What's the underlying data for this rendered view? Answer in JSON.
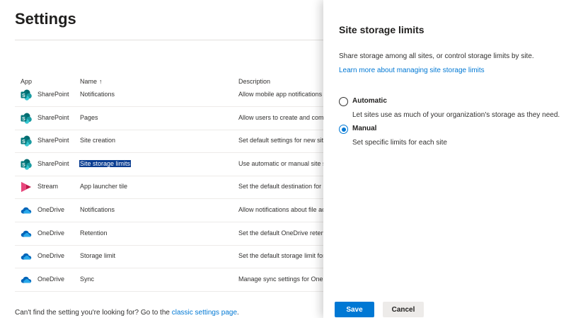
{
  "page": {
    "title": "Settings",
    "columns": {
      "app": "App",
      "name": "Name",
      "name_sort_icon": "sort-ascending-icon",
      "description": "Description"
    },
    "rows": [
      {
        "app": "SharePoint",
        "icon": "sharepoint-icon",
        "name": "Notifications",
        "description": "Allow mobile app notifications al"
      },
      {
        "app": "SharePoint",
        "icon": "sharepoint-icon",
        "name": "Pages",
        "description": "Allow users to create and comm"
      },
      {
        "app": "SharePoint",
        "icon": "sharepoint-icon",
        "name": "Site creation",
        "description": "Set default settings for new sites"
      },
      {
        "app": "SharePoint",
        "icon": "sharepoint-icon",
        "name": "Site storage limits",
        "description": "Use automatic or manual site sto",
        "selected": true
      },
      {
        "app": "Stream",
        "icon": "stream-icon",
        "name": "App launcher tile",
        "description": "Set the default destination for St"
      },
      {
        "app": "OneDrive",
        "icon": "onedrive-icon",
        "name": "Notifications",
        "description": "Allow notifications about file acti"
      },
      {
        "app": "OneDrive",
        "icon": "onedrive-icon",
        "name": "Retention",
        "description": "Set the default OneDrive retentic"
      },
      {
        "app": "OneDrive",
        "icon": "onedrive-icon",
        "name": "Storage limit",
        "description": "Set the default storage limit for u"
      },
      {
        "app": "OneDrive",
        "icon": "onedrive-icon",
        "name": "Sync",
        "description": "Manage sync settings for OneDri"
      }
    ],
    "footer_text": "Can't find the setting you're looking for? Go to the ",
    "footer_link": "classic settings page",
    "footer_end": "."
  },
  "panel": {
    "title": "Site storage limits",
    "description": "Share storage among all sites, or control storage limits by site.",
    "learn_more": "Learn more about managing site storage limits",
    "options": [
      {
        "label": "Automatic",
        "description": "Let sites use as much of your organization's storage as they need.",
        "checked": false
      },
      {
        "label": "Manual",
        "description": "Set specific limits for each site",
        "checked": true
      }
    ],
    "save_label": "Save",
    "cancel_label": "Cancel"
  },
  "colors": {
    "accent": "#0078d4",
    "selection": "#0a3d91",
    "sharepoint": "#038387",
    "stream": "#bc1948",
    "onedrive": "#0364b8"
  }
}
